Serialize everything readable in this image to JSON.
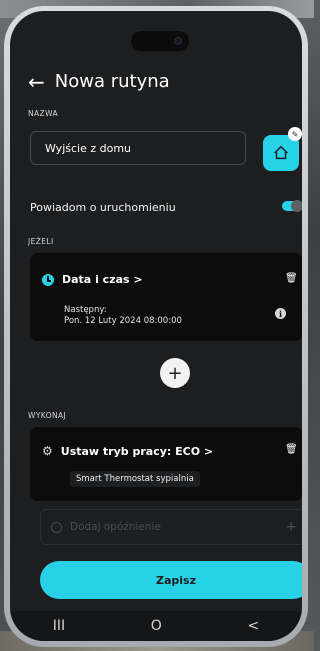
{
  "header": {
    "back_symbol": "←",
    "title": "Nowa rutyna"
  },
  "name_section": {
    "label": "NAZWA",
    "value": "Wyjście z domu"
  },
  "notify": {
    "label": "Powiadom o uruchomieniu",
    "enabled": true
  },
  "condition_section": {
    "label": "JEŻELI",
    "card": {
      "title": "Data i czas >",
      "next_label": "Następny:",
      "next_value": "Pon. 12 Luty 2024 08:00:00"
    }
  },
  "add_condition": {
    "symbol": "+"
  },
  "action_section": {
    "label": "WYKONAJ",
    "card": {
      "title": "Ustaw tryb pracy: ECO >",
      "device": "Smart Thermostat sypialnia"
    }
  },
  "delay": {
    "label": "Dodaj opóźnienie",
    "plus": "+"
  },
  "save_button": {
    "label": "Zapisz"
  },
  "navbar": {
    "recent": "III",
    "home": "O",
    "back": "<"
  },
  "colors": {
    "accent": "#27d2e6",
    "background": "#1d1e20",
    "card": "#0c0c0d"
  },
  "icons": {
    "home": "home-outline-icon",
    "edit": "pencil-icon",
    "clock": "clock-icon",
    "trash": "trash-icon",
    "info": "info-icon",
    "gear": "gear-icon"
  }
}
